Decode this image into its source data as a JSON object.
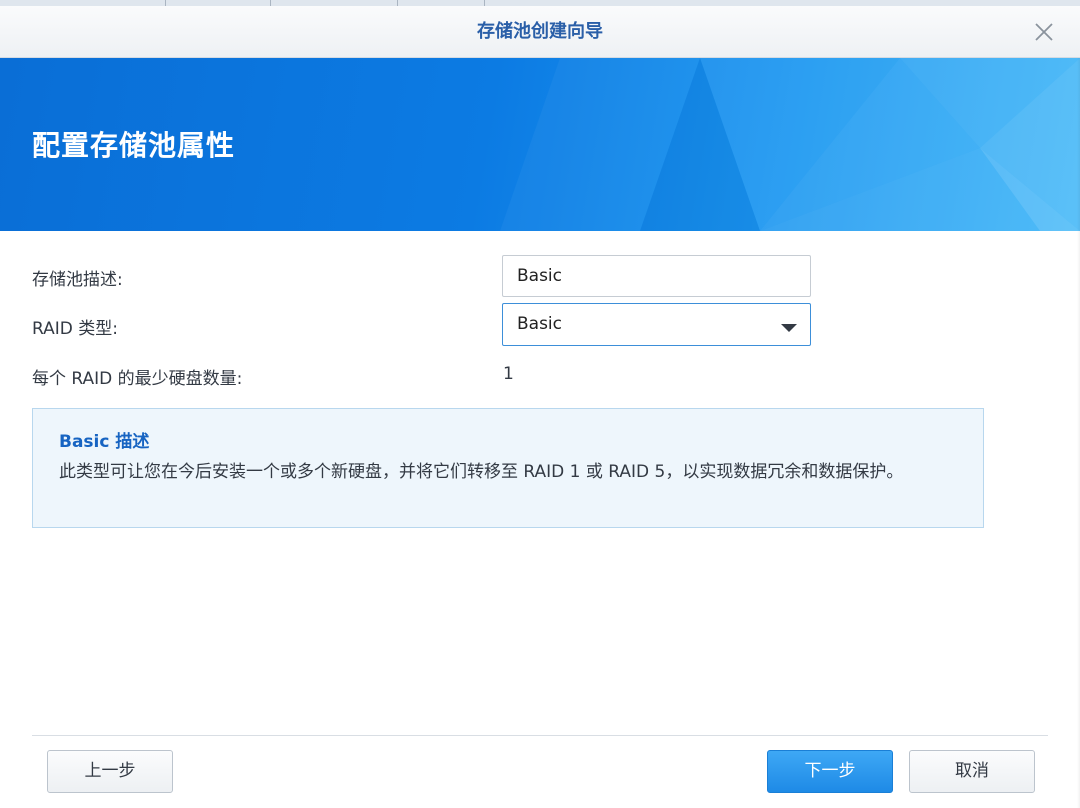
{
  "dialog": {
    "title": "存储池创建向导",
    "close_icon": "close-icon"
  },
  "banner": {
    "heading": "配置存储池属性"
  },
  "form": {
    "description_label": "存储池描述:",
    "description_value": "Basic",
    "raid_type_label": "RAID 类型:",
    "raid_type_value": "Basic",
    "min_disks_label": "每个 RAID 的最少硬盘数量:",
    "min_disks_value": "1"
  },
  "info": {
    "title": "Basic 描述",
    "text": "此类型可让您在今后安装一个或多个新硬盘，并将它们转移至 RAID 1 或 RAID 5，以实现数据冗余和数据保护。"
  },
  "footer": {
    "back_label": "上一步",
    "next_label": "下一步",
    "cancel_label": "取消"
  },
  "colors": {
    "accent": "#1e8ae6",
    "title_blue": "#2a5fa8",
    "banner_blue": "#0c7be3",
    "info_bg": "#eef6fc"
  }
}
